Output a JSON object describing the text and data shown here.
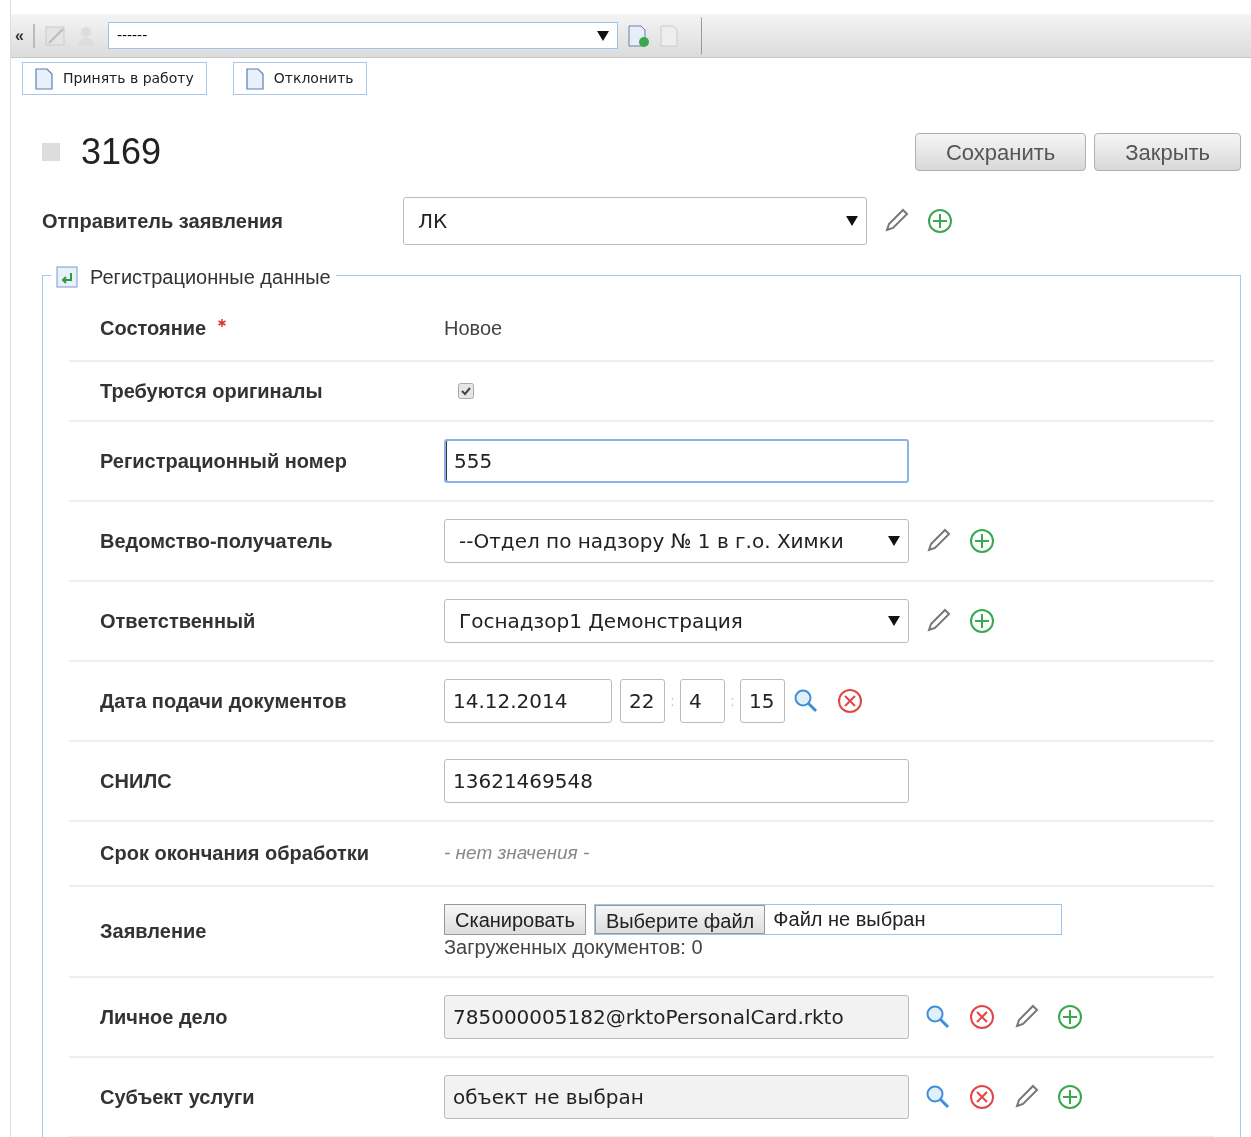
{
  "toolbar": {
    "collapse": "«",
    "select_value": "------"
  },
  "actions": [
    {
      "label": "Принять в работу"
    },
    {
      "label": "Отклонить"
    }
  ],
  "header": {
    "number": "3169",
    "buttons": [
      "Сохранить",
      "Закрыть"
    ]
  },
  "sender": {
    "label": "Отправитель заявления",
    "value": "ЛК"
  },
  "section": {
    "title": "Регистрационные данные",
    "rows": [
      {
        "kind": "text",
        "label": "Состояние",
        "required": true,
        "value": "Новое"
      },
      {
        "kind": "checkbox",
        "label": "Требуются оригиналы",
        "required": false,
        "checked": true
      },
      {
        "kind": "input",
        "label": "Регистрационный номер",
        "required": false,
        "value": "555",
        "focused": true
      },
      {
        "kind": "select",
        "label": "Ведомство-получатель",
        "required": false,
        "value": "--Отдел по надзору № 1 в г.о. Химки"
      },
      {
        "kind": "select",
        "label": "Ответственный",
        "required": false,
        "value": "Госнадзор1 Демонстрация"
      },
      {
        "kind": "datetime",
        "label": "Дата подачи документов",
        "required": false,
        "date": "14.12.2014",
        "time_parts": [
          "22",
          "4",
          "15"
        ],
        "separators": [
          ":",
          ":"
        ]
      },
      {
        "kind": "input",
        "label": "СНИЛС",
        "required": false,
        "value": "13621469548",
        "focused": false
      },
      {
        "kind": "empty",
        "label": "Срок окончания обработки",
        "required": false,
        "value": "- нет значения -"
      },
      {
        "kind": "file",
        "label": "Заявление",
        "required": false,
        "scan_button": "Сканировать",
        "choose_button": "Выберите файл",
        "file_status": "Файл не выбран",
        "uploaded": "Загруженных документов: 0"
      },
      {
        "kind": "lookup",
        "label": "Личное дело",
        "required": false,
        "value": "785000005182@rktoPersonalCard.rkto"
      },
      {
        "kind": "lookup",
        "label": "Субъект услуги",
        "required": false,
        "value": "объект не выбран"
      }
    ]
  }
}
